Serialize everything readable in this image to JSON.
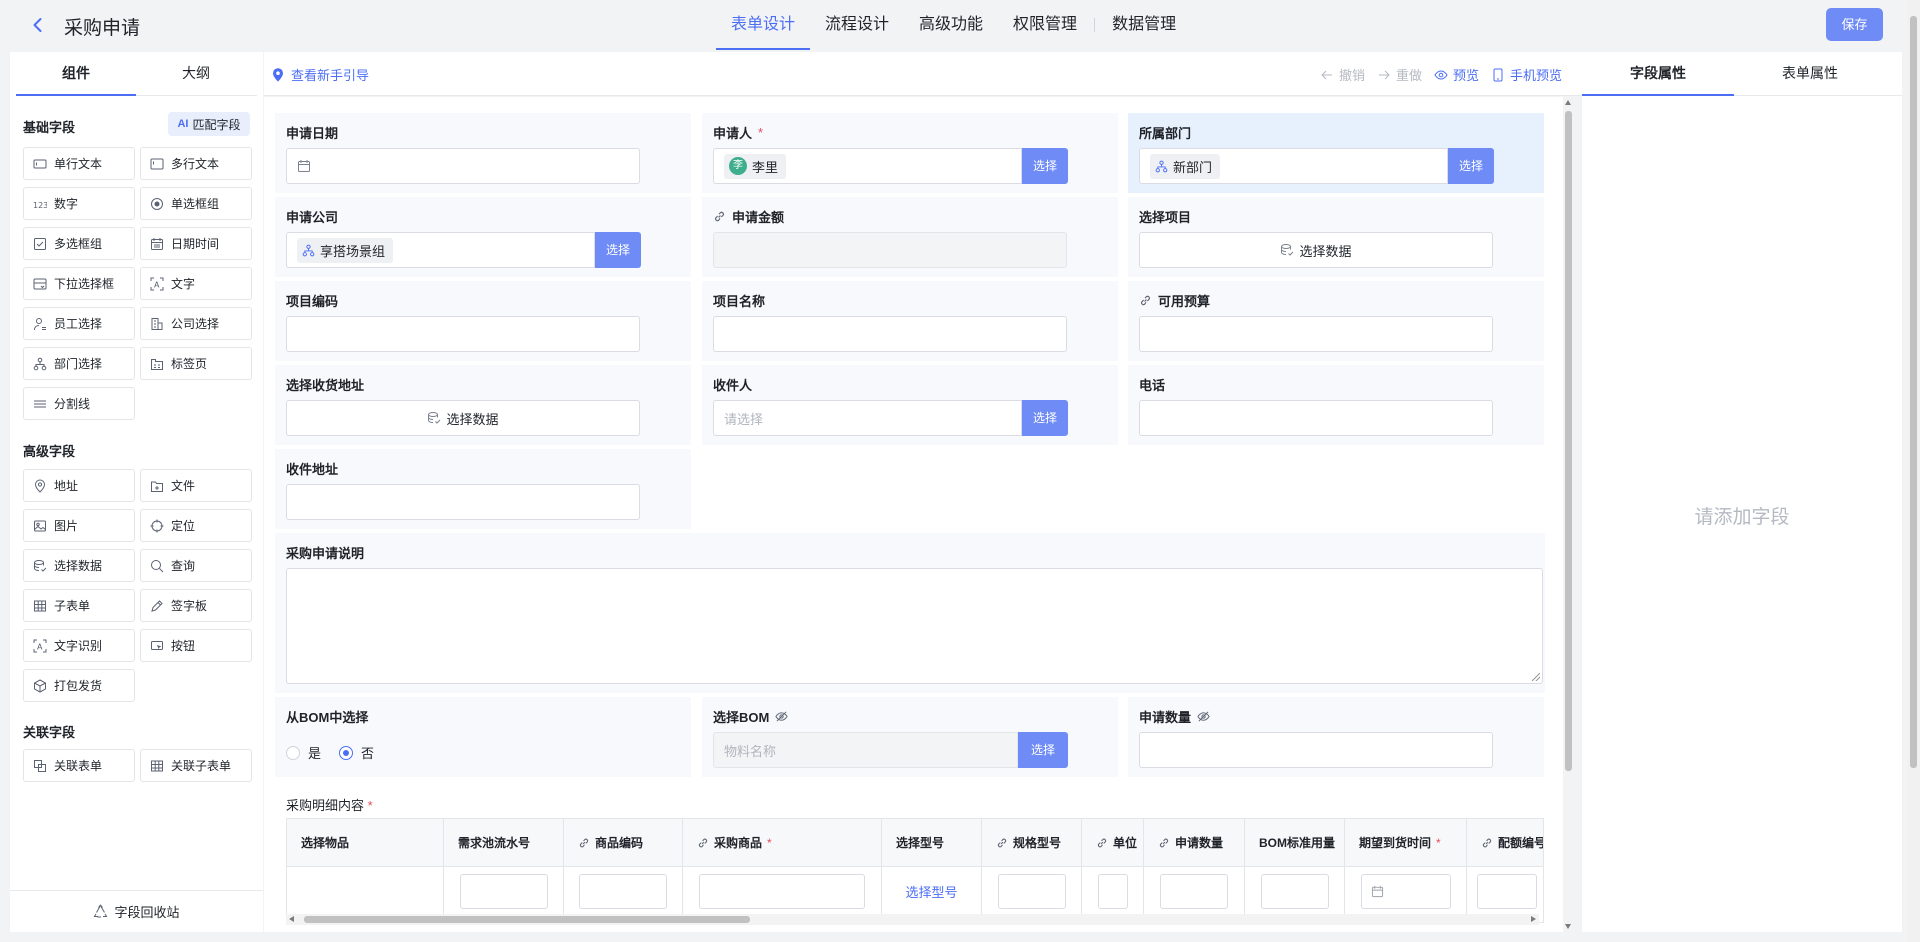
{
  "header": {
    "title": "采购申请",
    "tabs": [
      "表单设计",
      "流程设计",
      "高级功能",
      "权限管理",
      "数据管理"
    ],
    "active_tab": "表单设计",
    "save_label": "保存"
  },
  "left_panel": {
    "tabs": [
      "组件",
      "大纲"
    ],
    "active_tab": "组件",
    "match_label": "匹配字段",
    "match_prefix": "AI",
    "sections": {
      "basic": {
        "title": "基础字段",
        "items": [
          {
            "label": "单行文本",
            "icon": "single-line-text-icon"
          },
          {
            "label": "多行文本",
            "icon": "multi-line-text-icon"
          },
          {
            "label": "数字",
            "icon": "number-icon"
          },
          {
            "label": "单选框组",
            "icon": "radio-icon"
          },
          {
            "label": "多选框组",
            "icon": "checkbox-icon"
          },
          {
            "label": "日期时间",
            "icon": "calendar-icon"
          },
          {
            "label": "下拉选择框",
            "icon": "dropdown-icon"
          },
          {
            "label": "文字",
            "icon": "text-icon"
          },
          {
            "label": "员工选择",
            "icon": "user-icon"
          },
          {
            "label": "公司选择",
            "icon": "company-icon"
          },
          {
            "label": "部门选择",
            "icon": "org-tree-icon"
          },
          {
            "label": "标签页",
            "icon": "tabs-icon"
          },
          {
            "label": "分割线",
            "icon": "divider-icon"
          }
        ]
      },
      "advanced": {
        "title": "高级字段",
        "items": [
          {
            "label": "地址",
            "icon": "location-pin-icon"
          },
          {
            "label": "文件",
            "icon": "file-icon"
          },
          {
            "label": "图片",
            "icon": "image-icon"
          },
          {
            "label": "定位",
            "icon": "crosshair-icon"
          },
          {
            "label": "选择数据",
            "icon": "database-icon"
          },
          {
            "label": "查询",
            "icon": "search-icon"
          },
          {
            "label": "子表单",
            "icon": "table-icon"
          },
          {
            "label": "签字板",
            "icon": "pen-icon"
          },
          {
            "label": "文字识别",
            "icon": "ocr-icon"
          },
          {
            "label": "按钮",
            "icon": "button-icon"
          },
          {
            "label": "打包发货",
            "icon": "package-icon"
          }
        ]
      },
      "related": {
        "title": "关联字段",
        "items": [
          {
            "label": "关联表单",
            "icon": "link-form-icon"
          },
          {
            "label": "关联子表单",
            "icon": "table-icon"
          }
        ]
      }
    },
    "recycle_label": "字段回收站"
  },
  "toolbar": {
    "guide_label": "查看新手引导",
    "undo_label": "撤销",
    "redo_label": "重做",
    "preview_label": "预览",
    "mobile_preview_label": "手机预览"
  },
  "form": {
    "apply_date": {
      "label": "申请日期"
    },
    "applicant": {
      "label": "申请人",
      "required": "*",
      "value": "李里",
      "avatar": "李",
      "button": "选择"
    },
    "department": {
      "label": "所属部门",
      "value": "新部门",
      "button": "选择"
    },
    "company": {
      "label": "申请公司",
      "value": "享搭场景组",
      "button": "选择"
    },
    "amount": {
      "label": "申请金额"
    },
    "project_select": {
      "label": "选择项目",
      "value": "选择数据"
    },
    "project_code": {
      "label": "项目编码"
    },
    "project_name": {
      "label": "项目名称"
    },
    "budget": {
      "label": "可用预算"
    },
    "address_select": {
      "label": "选择收货地址",
      "value": "选择数据"
    },
    "receiver": {
      "label": "收件人",
      "placeholder": "请选择",
      "button": "选择"
    },
    "phone": {
      "label": "电话"
    },
    "recv_address": {
      "label": "收件地址"
    },
    "description": {
      "label": "采购申请说明"
    },
    "from_bom": {
      "label": "从BOM中选择",
      "options": [
        "是",
        "否"
      ],
      "selected": "否"
    },
    "bom_select": {
      "label": "选择BOM",
      "placeholder": "物料名称",
      "button": "选择"
    },
    "quantity": {
      "label": "申请数量"
    }
  },
  "subtable": {
    "label": "采购明细内容",
    "required": "*",
    "columns": [
      "选择物品",
      "需求池流水号",
      "商品编码",
      "采购商品",
      "选择型号",
      "规格型号",
      "单位",
      "申请数量",
      "BOM标准用量",
      "期望到货时间",
      "配额编号"
    ],
    "select_model_link": "选择型号"
  },
  "right_panel": {
    "tabs": [
      "字段属性",
      "表单属性"
    ],
    "active_tab": "字段属性",
    "empty_text": "请添加字段"
  },
  "colors": {
    "accent": "#4c6ef5",
    "button": "#6f8cf6",
    "selected_field_bg": "#e7f0fd",
    "required": "#e34d59"
  }
}
